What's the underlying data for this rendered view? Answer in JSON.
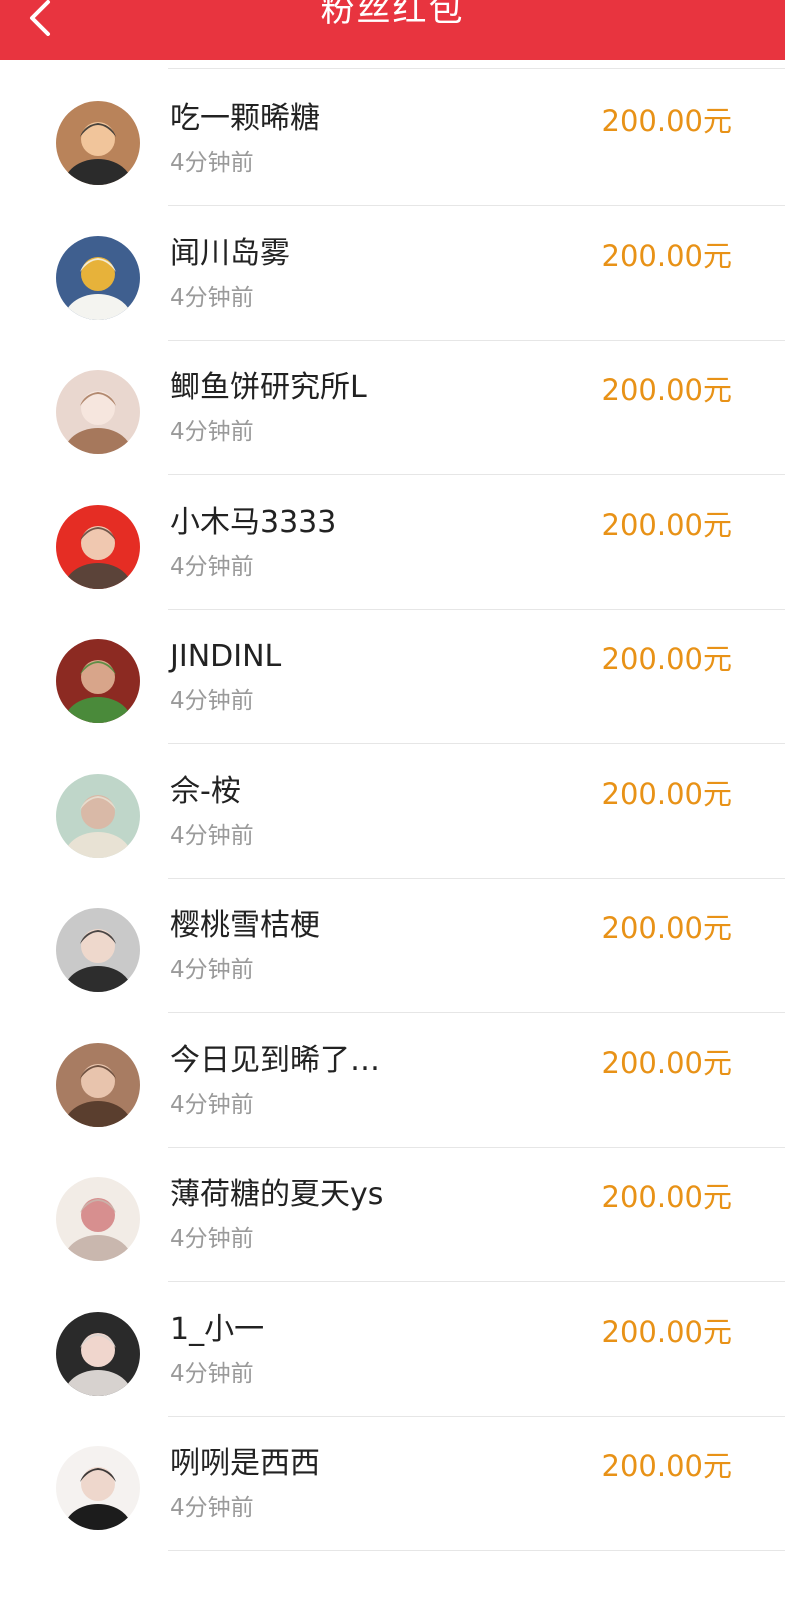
{
  "header": {
    "title": "粉丝红包",
    "back_icon": "chevron-left-icon",
    "background": "#e8343f"
  },
  "accent_color": "#e89217",
  "items": [
    {
      "name": "吃一颗晞糖",
      "time": "4分钟前",
      "amount": "200.00元",
      "avatar_colors": [
        "#b9835a",
        "#2b2b2b",
        "#f1c59b"
      ]
    },
    {
      "name": "闻川岛雾",
      "time": "4分钟前",
      "amount": "200.00元",
      "avatar_colors": [
        "#3f5f8f",
        "#f4f4f0",
        "#e7b23a"
      ]
    },
    {
      "name": "鲫鱼饼研究所L",
      "time": "4分钟前",
      "amount": "200.00元",
      "avatar_colors": [
        "#e9d7cf",
        "#a6785c",
        "#f6e6de"
      ]
    },
    {
      "name": "小木马3333",
      "time": "4分钟前",
      "amount": "200.00元",
      "avatar_colors": [
        "#e52d24",
        "#5b4339",
        "#f0c8b0"
      ]
    },
    {
      "name": "JINDINL",
      "time": "4分钟前",
      "amount": "200.00元",
      "avatar_colors": [
        "#8c2a22",
        "#4a8a3a",
        "#d8a58a"
      ]
    },
    {
      "name": "佘-桉",
      "time": "4分钟前",
      "amount": "200.00元",
      "avatar_colors": [
        "#bfd6c9",
        "#e8e2d4",
        "#d9b9a7"
      ]
    },
    {
      "name": "樱桃雪桔梗",
      "time": "4分钟前",
      "amount": "200.00元",
      "avatar_colors": [
        "#c9c9c9",
        "#2d2d2d",
        "#eed8cc"
      ]
    },
    {
      "name": "今日见到晞了…",
      "time": "4分钟前",
      "amount": "200.00元",
      "avatar_colors": [
        "#a87c62",
        "#5a3e2e",
        "#e8c4ad"
      ]
    },
    {
      "name": "薄荷糖的夏天ys",
      "time": "4分钟前",
      "amount": "200.00元",
      "avatar_colors": [
        "#f2ece6",
        "#c9b7ae",
        "#d78f8f"
      ]
    },
    {
      "name": "1_小一",
      "time": "4分钟前",
      "amount": "200.00元",
      "avatar_colors": [
        "#2a2a2a",
        "#d7d2cf",
        "#f0d6cd"
      ]
    },
    {
      "name": "咧咧是西西",
      "time": "4分钟前",
      "amount": "200.00元",
      "avatar_colors": [
        "#f5f2f0",
        "#1c1c1c",
        "#eed7cc"
      ]
    }
  ]
}
